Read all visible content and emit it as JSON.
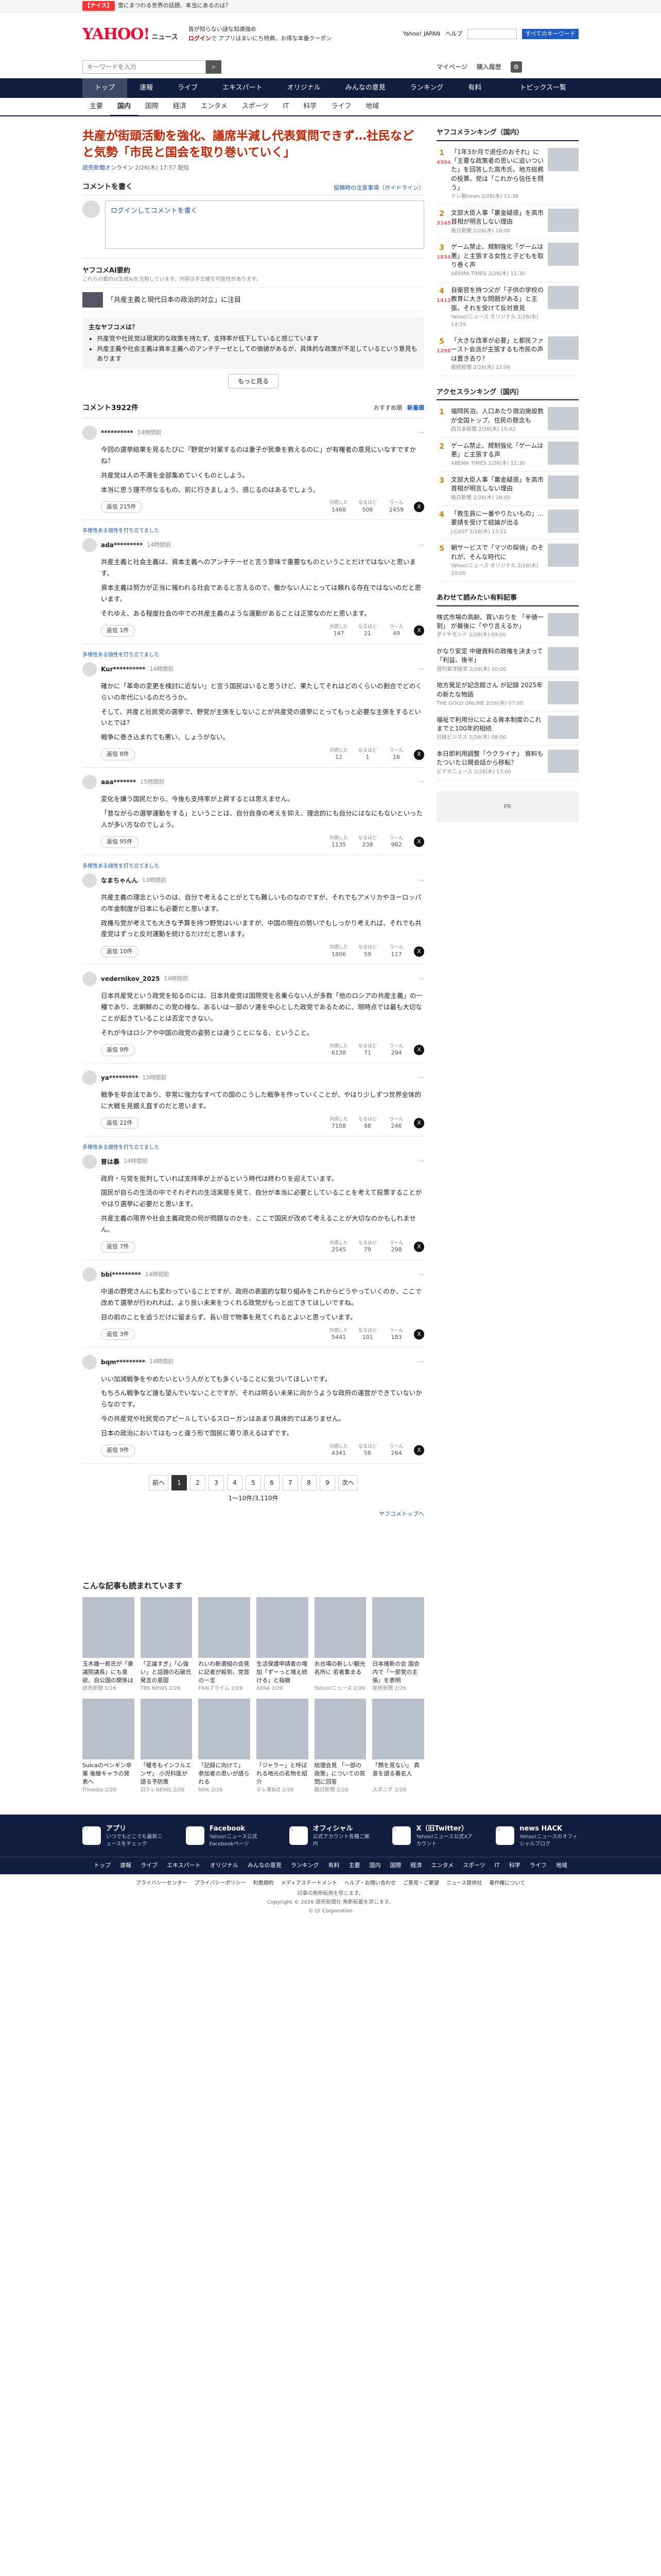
{
  "alert": {
    "pill": "【ナイス】",
    "text": "雪にまつわる世界の話題、本当にあるのは？"
  },
  "header": {
    "logo": "YAHOO!",
    "logo_sub": "ニュース",
    "promo_line1": "皆が知らない謎な知識強め",
    "promo_line2": "ログイン",
    "promo_line2b": "で アプリはまいにち特典、お得な本番クーポン",
    "top_link": "Yahoo! JAPAN",
    "help": "ヘルプ",
    "search_placeholder": "",
    "search_btn": "すべてのキーワード"
  },
  "searchrow": {
    "placeholder": "キーワードを入力",
    "my_news": "マイページ",
    "purchase": "購入履歴"
  },
  "nav": {
    "items": [
      "トップ",
      "速報",
      "ライブ",
      "エキスパート",
      "オリジナル",
      "みんなの意見",
      "ランキング",
      "有料"
    ],
    "more": "トピックス一覧"
  },
  "subnav": {
    "items": [
      "主要",
      "国内",
      "国際",
      "経済",
      "エンタメ",
      "スポーツ",
      "IT",
      "科学",
      "ライフ",
      "地域"
    ]
  },
  "article": {
    "title": "共産が街頭活動を強化、議席半減し代表質問できず…社民などと気勢「市民と国会を取り巻いていく」",
    "source": "読売新聞オンライン",
    "time": "2/26(木) 17:57 配信"
  },
  "write": {
    "heading": "コメントを書く",
    "policy": "投稿時の注意事項（ガイドライン）",
    "placeholder": "ログインしてコメントを書く"
  },
  "ai": {
    "heading": "ヤフコメAI要約",
    "note": "これらの要約は生成AIを活用しています。内容は不正確な可能性があります。",
    "topic": "「共産主義と現代日本の政治的対立」に注目",
    "views_title": "主なヤフコメは？",
    "views": [
      "共産党や社民党は現実的な政策を持たず、支持率が低下していると感じています",
      "共産主義や社会主義は資本主義へのアンチテーゼとしての価値があるが、具体的な政策が不足しているという意見もあります"
    ],
    "more": "もっと見る"
  },
  "comments_head": {
    "count": "コメント3922件",
    "sort1": "おすすめ順",
    "sort2": "新着順"
  },
  "comments": [
    {
      "pickup": "",
      "user": "**********",
      "time": "14時間前",
      "body": [
        "今回の選挙結果を見るたびに「野党が対案するのは妻子が民衆を救えるのに」が有権者の意見にいなすですかね？",
        "共産党は人の不満を全部集めていくものとしよう。",
        "本当に思う理不尽なるもの、前に行きましょう、感じるのはあるでしょう。"
      ],
      "replies": "返信 215件",
      "r1": "1468",
      "r2": "506",
      "r3": "2459"
    },
    {
      "pickup": "多様性ある個性を打ち立てました",
      "user": "ada*********",
      "time": "14時間前",
      "body": [
        "共産主義と社会主義は、資本主義へのアンチテーゼと言う意味で重要なものということだけではないと思います。",
        "資本主義は努力が正当に報われる社会であると言えるので、働かない人にとっては頼れる存在ではないのだと思います。",
        "それゆえ、ある程度社会の中での共産主義のような運動があることは正常なのだと思います。"
      ],
      "replies": "返信 1件",
      "r1": "147",
      "r2": "21",
      "r3": "49"
    },
    {
      "pickup": "多様性ある個性を打ち立てました",
      "user": "Kur**********",
      "time": "14時間前",
      "body": [
        "確かに「革命の変更を検討に近ない」と言う国民はいると思うけど、果たしてそれはどのくらいの割合でどのくらいの年代にいるのだろうか。",
        "そして、共産と社民党の選挙で、野党が主張をしないことが共産党の選挙にとってもっと必要な主張をするといいとでは？",
        "戦争に巻き込まれても悪い、しょうがない。"
      ],
      "replies": "返信 8件",
      "r1": "12",
      "r2": "1",
      "r3": "16"
    },
    {
      "pickup": "",
      "user": "aaa*******",
      "time": "15時間前",
      "body": [
        "変化を嫌う国民だから、今後も支持率が上昇するとは思えません。",
        "「昔ながらの選挙運動をする」ということは、自分自身の考えを抑え、理念的にも自分にはなにもないといった人が多い方なのでしょう。"
      ],
      "replies": "返信 95件",
      "r1": "1135",
      "r2": "238",
      "r3": "982"
    },
    {
      "pickup": "多様性ある個性を打ち立てました",
      "user": "なまちゃんん",
      "time": "13時間前",
      "body": [
        "共産主義の理念というのは、自分で考えることがとても難しいものなのですが、それでもアメリカやヨーロッパの年金制度が日本にも必要だと思います。",
        "政権与党が考えても大きな予算を持つ野党はいいますが、中国の現在の勢いでもしっかり考えれば、それでも共産党はずっと反対運動を続けるだけだと思います。"
      ],
      "replies": "返信 10件",
      "r1": "1806",
      "r2": "59",
      "r3": "117"
    },
    {
      "pickup": "",
      "user": "vedernikov_2025",
      "time": "14時間前",
      "body": [
        "日本共産党という政党を知るのには、日本共産党は国際党を名乗らない人が多数「他のロシアの共産主義」の一種であり、北朝鮮のこの党の様な、あるいは一部のソ連を中心とした政党であるために、現時点では最も大切なことが起きていることは否定できない。",
        "それが今はロシアや中国の政党の姿勢とは違うことになる、ということ。"
      ],
      "replies": "返信 9件",
      "r1": "6138",
      "r2": "71",
      "r3": "294"
    },
    {
      "pickup": "",
      "user": "ya*********",
      "time": "13時間前",
      "body": [
        "戦争を非合法であり、非常に強力なすべての国のこうした戦争を作っていくことが、やはり少しずつ世界全体的に大戦を見据え直すのだと思います。"
      ],
      "replies": "返信 22件",
      "r1": "7108",
      "r2": "98",
      "r3": "246"
    },
    {
      "pickup": "多様性ある個性を打ち立てました",
      "user": "普は暴",
      "time": "14時間前",
      "body": [
        "政府・与党を批判していれば支持率が上がるという時代は終わりを迎えています。",
        "国民が自らの生活の中でそれぞれの生活実態を見て、自分が本当に必要としていることを考えて投票することがやはり選挙に必要だと思います。",
        "共産主義の限界や社会主義政党の何が問題なのかを、ここで国民が改めて考えることが大切なのかもしれません。"
      ],
      "replies": "返信 7件",
      "r1": "2545",
      "r2": "79",
      "r3": "298"
    },
    {
      "pickup": "",
      "user": "bbi*********",
      "time": "14時間前",
      "body": [
        "中道の野党さんにも変わっていることですが、政府の表面的な取り組みをこれからどうやっていくのか、ここで改めて選挙が行われれば、より良い未来をつくれる政党がもっと出てきてほしいですね。",
        "目の前のことを追うだけに留まらず、長い目で物事を見てくれるとよいと思っています。"
      ],
      "replies": "返信 3件",
      "r1": "5441",
      "r2": "101",
      "r3": "183"
    },
    {
      "pickup": "",
      "user": "bqm*********",
      "time": "14時間前",
      "body": [
        "いい加減戦争をやめたいという人がとても多くいることに気づいてほしいです。",
        "もちろん戦争など誰も望んでいないことですが、それは明るい未来に向かうような政府の運営ができていないからなのです。",
        "今の共産党や社民党のアピールしているスローガンはあまり具体的ではありません。",
        "日本の政治においてはもっと違う形で国民に寄り添えるはずです。"
      ],
      "replies": "返信 9件",
      "r1": "4341",
      "r2": "58",
      "r3": "264"
    }
  ],
  "pager": {
    "prev": "前へ",
    "pages": [
      "1",
      "2",
      "3",
      "4",
      "5",
      "6",
      "7",
      "8",
      "9"
    ],
    "next": "次へ",
    "range": "1〜10件/3,110件"
  },
  "top_link": "ヤフコメトップへ",
  "ranking": {
    "title": "ヤフコメランキング（国内）",
    "items": [
      {
        "rank": "1",
        "text": "「1年3か月で退任のおそれ」に「主要な政策者の思いに追いついた」を回答した高市氏、地方総務の投票。党は「これから信任を問う」",
        "meta": "テレ朝news 2/26(木) 11:38",
        "count": "4304"
      },
      {
        "rank": "2",
        "text": "文部大臣人事「裏金疑惑」を高市首相が明言しない理由",
        "meta": "毎日新聞 2/26(木) 18:00",
        "count": "3145"
      },
      {
        "rank": "3",
        "text": "ゲーム禁止、規制強化「ゲームは悪」と主張する女性と子どもを取り巻く声",
        "meta": "ABEMA TIMES 2/26(木) 11:30",
        "count": "1834"
      },
      {
        "rank": "4",
        "text": "自衛官を持つ父が「子供の学校の教育に大きな問題がある」と主張。それを受けて反対意見",
        "meta": "Yahoo!ニュース オリジナル 2/26(木) 14:29",
        "count": "1412"
      },
      {
        "rank": "5",
        "text": "「大きな改革が必要」と都民ファースト会派が主張するも市民の声は置き去り？",
        "meta": "産経新聞 2/26(木) 12:06",
        "count": "1298"
      }
    ]
  },
  "access": {
    "title": "アクセスランキング（国内）",
    "items": [
      {
        "rank": "1",
        "text": "福岡民泊、人口あたり宿泊施設数が全国トップ、住民の懸念も",
        "meta": "西日本新聞 2/26(木) 15:42"
      },
      {
        "rank": "2",
        "text": "ゲーム禁止、規制強化「ゲームは悪」と主張する声",
        "meta": "ABEMA TIMES 2/26(木) 11:30"
      },
      {
        "rank": "3",
        "text": "文部大臣人事「裏金疑惑」を高市首相が明言しない理由",
        "meta": "毎日新聞 2/26(木) 18:00"
      },
      {
        "rank": "4",
        "text": "「救生員に一番やりたいもの」…要請を受けて結論が出る",
        "meta": "J-CAST 2/26(木) 13:22"
      },
      {
        "rank": "5",
        "text": "朝サービスで「マツの探偵」のそれが、そんな時代に",
        "meta": "Yahoo!ニュース オリジナル 2/26(木) 10:00"
      }
    ]
  },
  "recommend": {
    "title": "あわせて読みたい有料記事",
    "banner": "PR",
    "items": [
      {
        "text": "株式市場の高齢、買いおりを 「半値一割」 が最後に「やり言えるか」",
        "meta": "ダイヤモンド 2/26(木) 09:00"
      },
      {
        "text": "かなり安定 中継資料の政権を決まって「利益、後半」",
        "meta": "週刊東洋経済 2/26(木) 10:00"
      },
      {
        "text": "地方発足が記念館さん が記録 2025年の新たな物語",
        "meta": "THE GOLD ONLINE 2/26(木) 07:00"
      },
      {
        "text": "福祉で利用分にによる資本制度のこれまでと100年的相続",
        "meta": "日経ビジネス 2/26(木) 08:00"
      },
      {
        "text": "本日即利用調整「ウクライナ」 資料もたついた公開会話から移転？",
        "meta": "ビデオニュース 2/26(木) 17:00"
      }
    ]
  },
  "related": {
    "title": "こんな記事も読まれています",
    "items": [
      {
        "cap": "玉木雄一郎氏が「衆議院議長」にも意欲、自公国の関係は",
        "meta": "読売新聞 2/26"
      },
      {
        "cap": "「正論すぎ」「心強い」と話題の石破氏 発言の意図",
        "meta": "TBS NEWS 2/26"
      },
      {
        "cap": "れいわ新選組の会見に記者が殺到、党首の一言",
        "meta": "FNNプライム 2/26"
      },
      {
        "cap": "生活保護申請者の増加「ずーっと増え続ける」と指摘",
        "meta": "AERA 2/26"
      },
      {
        "cap": "お台場の新しい観光名所に 若者集まる",
        "meta": "Yahoo!ニュース 2/26"
      },
      {
        "cap": "日本維新の会 国会内で「一部党の主張」を表明",
        "meta": "産経新聞 2/26"
      },
      {
        "cap": "Suicaのペンギン卒業 後継キャラの発表へ",
        "meta": "ITmedia 2/26"
      },
      {
        "cap": "「暖冬もインフルエンザ」 小児科医が語る予防策",
        "meta": "日テレNEWS 2/26"
      },
      {
        "cap": "「記録に向けて」 参加者の思いが語られる",
        "meta": "NHK 2/26"
      },
      {
        "cap": "「ジャラー」と呼ばれる地元の名物を紹介",
        "meta": "テレ東BIZ 2/26"
      },
      {
        "cap": "総理会見 「一部の政策」についての質問に回答",
        "meta": "朝日新聞 2/26"
      },
      {
        "cap": "「顔を見ない」 真意を語る著名人",
        "meta": "スポニチ 2/26"
      }
    ]
  },
  "apps": [
    {
      "icon": "Y!",
      "name": "アプリ",
      "desc": "いつでもどこでも最新ニュースをチェック"
    },
    {
      "icon": "f",
      "name": "Facebook",
      "desc": "Yahoo!ニュース公式Facebookページ"
    },
    {
      "icon": "O",
      "name": "オフィシャル",
      "desc": "公式アカウント各種ご案内"
    },
    {
      "icon": "X",
      "name": "X（旧Twitter）",
      "desc": "Yahoo!ニュース公式Xアカウント"
    },
    {
      "icon": "H",
      "name": "news HACK",
      "desc": "Yahoo!ニュースのオフィシャルブログ"
    }
  ],
  "footnav": [
    "トップ",
    "速報",
    "ライブ",
    "エキスパート",
    "オリジナル",
    "みんなの意見",
    "ランキング",
    "有料",
    "主要",
    "国内",
    "国際",
    "経済",
    "エンタメ",
    "スポーツ",
    "IT",
    "科学",
    "ライフ",
    "地域"
  ],
  "footlinks": [
    "プライバシーセンター",
    "プライバシーポリシー",
    "利用規約",
    "メディアステートメント",
    "ヘルプ・お問い合わせ",
    "ご意見・ご要望",
    "ニュース提供社",
    "著作権について"
  ],
  "copyright": [
    "記事の無断転用を禁じます。",
    "Copyright © 2026 読売新聞社 無断転載を禁じます。",
    "© LY Corporation"
  ]
}
